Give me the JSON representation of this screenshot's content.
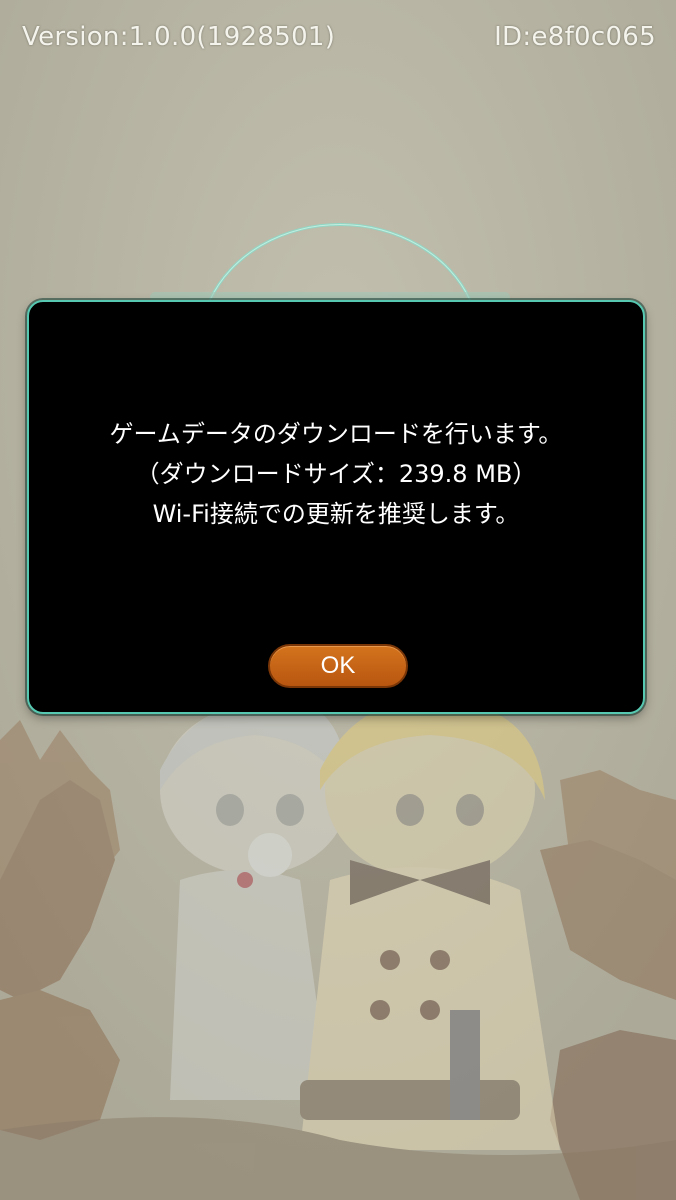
{
  "header": {
    "version": "Version:1.0.0(1928501)",
    "id": "ID:e8f0c065"
  },
  "dialog": {
    "lines": [
      "ゲームデータのダウンロードを行います。",
      "（ダウンロードサイズ：239.8 MB）",
      "Wi-Fi接続での更新を推奨します。"
    ],
    "ok_label": "OK"
  },
  "colors": {
    "background": "#b5b2a0",
    "dialog_background": "#000000",
    "dialog_border": "#57c8b1",
    "button": "#c8661a"
  }
}
